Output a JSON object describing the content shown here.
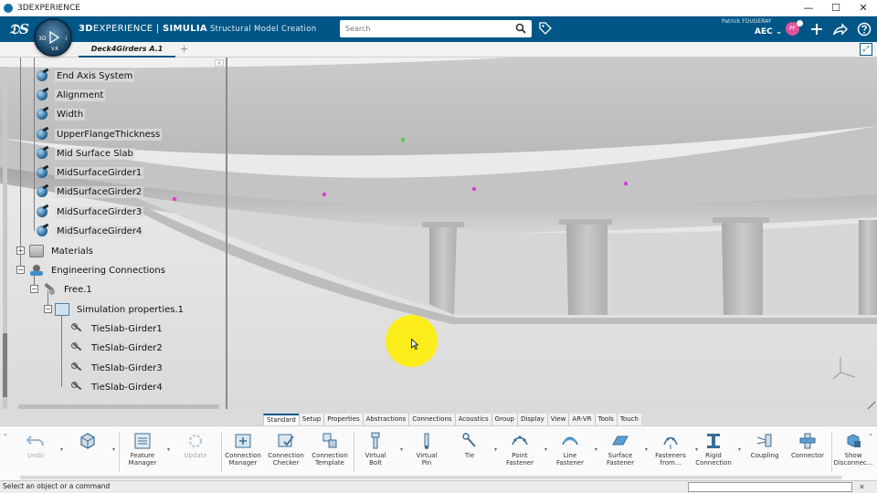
{
  "window": {
    "title": "3DEXPERIENCE",
    "minimize": "—",
    "maximize": "☐",
    "close": "✕"
  },
  "header": {
    "brand_3d": "3D",
    "brand_experience": "EXPERIENCE",
    "brand_separator": " | ",
    "brand_simulia": "SIMULIA",
    "app_name": " Structural Model Creation",
    "search_placeholder": "Search",
    "user_name": "Patrick FOUGERAY",
    "role": "AEC",
    "avatar_initials": "PF"
  },
  "compass": {
    "left": "3D",
    "center": "V.R",
    "right": "i"
  },
  "tabs": [
    {
      "label": "Deck4Girders A.1"
    }
  ],
  "tree": {
    "nodes": [
      {
        "label": "End Axis System"
      },
      {
        "label": "Alignment"
      },
      {
        "label": "Width"
      },
      {
        "label": "UpperFlangeThickness"
      },
      {
        "label": "Mid Surface Slab"
      },
      {
        "label": "MidSurfaceGirder1"
      },
      {
        "label": "MidSurfaceGirder2"
      },
      {
        "label": "MidSurfaceGirder3"
      },
      {
        "label": "MidSurfaceGirder4"
      },
      {
        "label": "Materials"
      },
      {
        "label": "Engineering Connections"
      },
      {
        "label": "Free.1"
      },
      {
        "label": "Simulation properties.1"
      },
      {
        "label": "TieSlab-Girder1"
      },
      {
        "label": "TieSlab-Girder2"
      },
      {
        "label": "TieSlab-Girder3"
      },
      {
        "label": "TieSlab-Girder4"
      }
    ]
  },
  "sections": [
    {
      "label": "Standard",
      "active": true
    },
    {
      "label": "Setup"
    },
    {
      "label": "Properties"
    },
    {
      "label": "Abstractions"
    },
    {
      "label": "Connections"
    },
    {
      "label": "Acoustics"
    },
    {
      "label": "Group"
    },
    {
      "label": "Display"
    },
    {
      "label": "View"
    },
    {
      "label": "AR-VR"
    },
    {
      "label": "Tools"
    },
    {
      "label": "Touch"
    }
  ],
  "actions": {
    "undo": "Undo",
    "update": "Update",
    "feature_manager": "Feature\nManager",
    "connection_manager": "Connection\nManager",
    "connection_checker": "Connection\nChecker",
    "connection_template": "Connection\nTemplate",
    "virtual_bolt": "Virtual\nBolt",
    "virtual_pin": "Virtual\nPin",
    "tie": "Tie",
    "point_fastener": "Point\nFastener",
    "line_fastener": "Line\nFastener",
    "surface_fastener": "Surface\nFastener",
    "fasteners_from": "Fasteners\nfrom...",
    "rigid_connection": "Rigid\nConnection",
    "coupling": "Coupling",
    "connector": "Connector",
    "show_disconnect": "Show\nDisconnec..."
  },
  "status": {
    "message": "Select an object or a command"
  },
  "colors": {
    "header_bg": "#005686",
    "accent": "#005686",
    "highlight": "#ffee00",
    "point_magenta": "#e23ad6",
    "point_green": "#43d243"
  }
}
